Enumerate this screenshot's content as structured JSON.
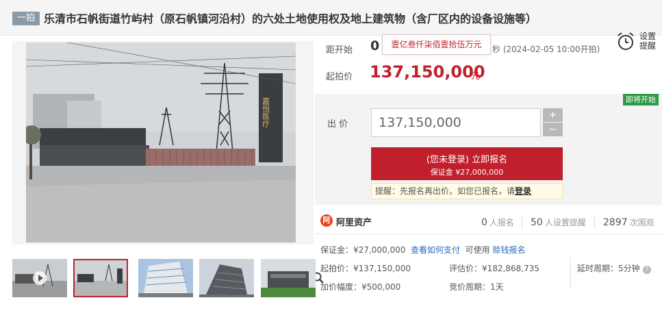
{
  "auction": {
    "badge": "一拍",
    "title": "乐清市石帆街道竹屿村（原石帆镇河沿村）的六处土地使用权及地上建筑物（含厂区内的设备设施等）"
  },
  "timing": {
    "label": "距开始",
    "countdown": "0",
    "tooltip": "壹亿叁仟柒佰壹拾伍万元",
    "time_suffix": "秒 (2024-02-05 10:00开拍)"
  },
  "remind": {
    "line1": "设置",
    "line2": "提醒"
  },
  "starting": {
    "label": "起拍价",
    "price": "137,150,000",
    "unit": "元"
  },
  "bid": {
    "status_badge": "即将开始",
    "label": "出 价",
    "amount": "137,150,000",
    "plus": "+",
    "minus": "−",
    "signup_line1": "(您未登录) 立即报名",
    "signup_line2": "保证金 ¥27,000,000",
    "hint_text": "提醒：先报名再出价。如您已报名，请",
    "hint_link": "登录"
  },
  "platform": {
    "name": "阿里资产",
    "logo_glyph": "阿"
  },
  "stats": [
    {
      "value": "0",
      "label": "人报名"
    },
    {
      "value": "50",
      "label": "人设置提醒"
    },
    {
      "value": "2897",
      "label": "次围观"
    }
  ],
  "details": {
    "deposit_label": "保证金：¥27,000,000",
    "deposit_link": "查看如何支付",
    "usable_text": "可使用",
    "usable_link": "赊钱报名",
    "start_price": "起拍价：¥137,150,000",
    "appraisal": "评估价：¥182,868,735",
    "delay": "延时周期：5分钟",
    "increment": "加价幅度：¥500,000",
    "bid_period": "竞价周期：1天"
  },
  "colors": {
    "accent": "#c0202b",
    "status_green": "#2e9a45",
    "link_blue": "#2a6bb8"
  }
}
